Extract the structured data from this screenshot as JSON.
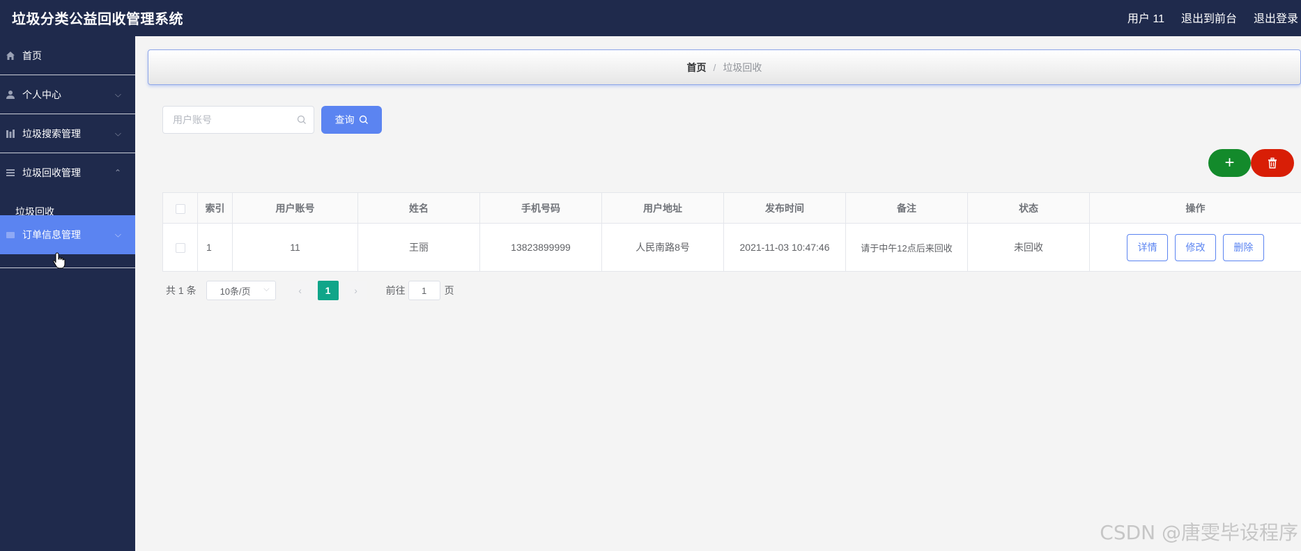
{
  "header": {
    "title": "垃圾分类公益回收管理系统",
    "user": "用户 11",
    "back_to_front": "退出到前台",
    "logout": "退出登录"
  },
  "sidebar": {
    "items": [
      {
        "label": "首页",
        "icon": "home-icon"
      },
      {
        "label": "个人中心",
        "icon": "user-icon"
      },
      {
        "label": "垃圾搜索管理",
        "icon": "chart-icon"
      },
      {
        "label": "垃圾回收管理",
        "icon": "list-icon",
        "sub": [
          "垃圾回收"
        ]
      },
      {
        "label": "订单信息管理",
        "icon": "order-icon"
      }
    ]
  },
  "breadcrumb": {
    "home": "首页",
    "separator": "/",
    "current": "垃圾回收"
  },
  "search": {
    "placeholder": "用户账号",
    "button": "查询"
  },
  "table": {
    "headers": [
      "索引",
      "用户账号",
      "姓名",
      "手机号码",
      "用户地址",
      "发布时间",
      "备注",
      "状态",
      "操作"
    ],
    "rows": [
      {
        "index": "1",
        "account": "11",
        "name": "王丽",
        "phone": "13823899999",
        "address": "人民南路8号",
        "time": "2021-11-03 10:47:46",
        "remark": "请于中午12点后来回收",
        "status": "未回收"
      }
    ],
    "actions": {
      "detail": "详情",
      "edit": "修改",
      "delete": "删除"
    }
  },
  "pagination": {
    "total": "共 1 条",
    "page_size": "10条/页",
    "current_page": "1",
    "goto_label": "前往",
    "goto_value": "1",
    "page_suffix": "页"
  },
  "watermark": "CSDN @唐雯毕设程序",
  "colors": {
    "header_bg": "#1f2a4c",
    "accent": "#5b84f1",
    "add": "#138a2b",
    "delete": "#d81e06",
    "page_active": "#10a589"
  }
}
